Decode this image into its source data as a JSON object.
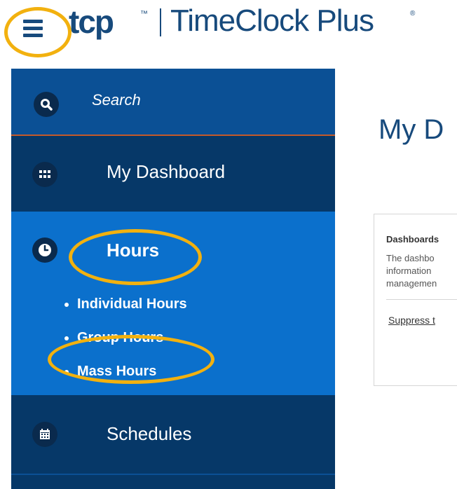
{
  "header": {
    "logo_mark": "tcp",
    "logo_tm": "™",
    "product_name": "TimeClock Plus",
    "product_reg": "®"
  },
  "sidebar": {
    "search_label": "Search",
    "items": [
      {
        "label": "My Dashboard",
        "icon": "grid-icon"
      },
      {
        "label": "Hours",
        "icon": "clock-icon",
        "sub_items": [
          "Individual Hours",
          "Group Hours",
          "Mass Hours"
        ]
      },
      {
        "label": "Schedules",
        "icon": "calendar-icon"
      }
    ]
  },
  "main": {
    "page_title": "My D",
    "card": {
      "title": "Dashboards",
      "body_lines": [
        "The dashbo",
        "information",
        "managemen"
      ],
      "link": "Suppress t"
    }
  },
  "colors": {
    "brand": "#174a7c",
    "sidebar": "#0b5095",
    "sidebar_dark": "#063868",
    "active": "#0b70cc",
    "annotation": "#f2b10f"
  }
}
